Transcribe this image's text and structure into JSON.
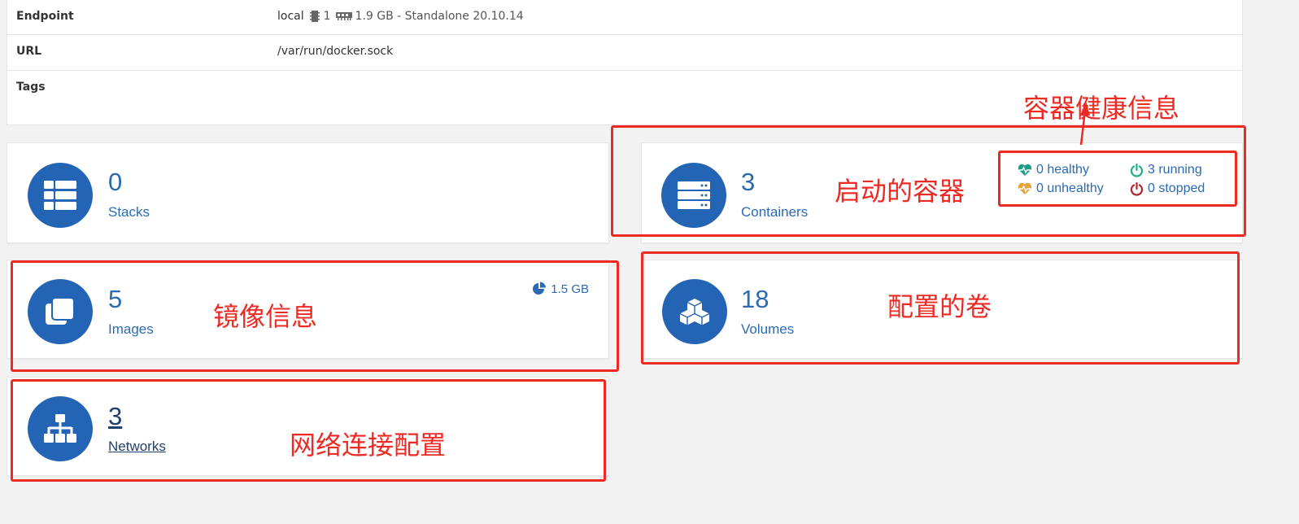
{
  "info": {
    "endpoint_label": "Endpoint",
    "endpoint_name": "local",
    "cpu_count": "1",
    "memory": "1.9 GB - Standalone 20.10.14",
    "url_label": "URL",
    "url_value": "/var/run/docker.sock",
    "tags_label": "Tags"
  },
  "widgets": {
    "stacks": {
      "count": "0",
      "label": "Stacks",
      "icon": "stacks-icon"
    },
    "containers": {
      "count": "3",
      "label": "Containers",
      "icon": "containers-icon",
      "healthy": "0 healthy",
      "unhealthy": "0 unhealthy",
      "running": "3 running",
      "stopped": "0 stopped"
    },
    "images": {
      "count": "5",
      "label": "Images",
      "size": "1.5 GB",
      "icon": "images-icon"
    },
    "volumes": {
      "count": "18",
      "label": "Volumes",
      "icon": "volumes-icon"
    },
    "networks": {
      "count": "3",
      "label": "Networks",
      "icon": "networks-icon"
    }
  },
  "annotations": {
    "health": "容器健康信息",
    "containers": "启动的容器",
    "images": "镜像信息",
    "volumes": "配置的卷",
    "networks": "网络连接配置"
  },
  "colors": {
    "accent": "#2364b4",
    "healthy": "#1e9e8a",
    "unhealthy": "#e8a33c",
    "running": "#23ae89",
    "stopped": "#b0262b",
    "annotation": "#ee2a24"
  }
}
